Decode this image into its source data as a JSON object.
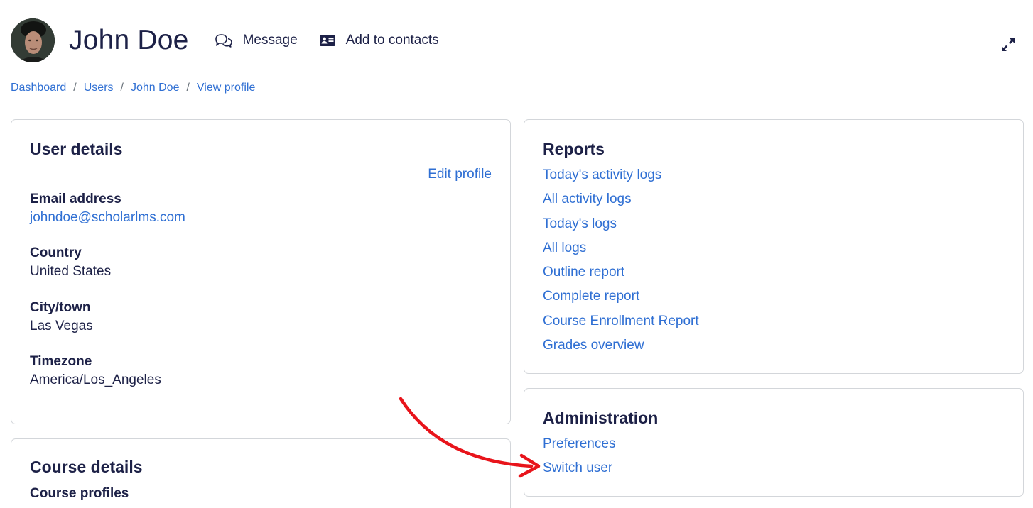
{
  "user": {
    "name": "John Doe"
  },
  "header_actions": {
    "message_label": "Message",
    "add_contacts_label": "Add to contacts"
  },
  "breadcrumb": [
    "Dashboard",
    "Users",
    "John Doe",
    "View profile"
  ],
  "user_details": {
    "title": "User details",
    "edit_label": "Edit profile",
    "fields": [
      {
        "label": "Email address",
        "value": "johndoe@scholarlms.com"
      },
      {
        "label": "Country",
        "value": "United States"
      },
      {
        "label": "City/town",
        "value": "Las Vegas"
      },
      {
        "label": "Timezone",
        "value": "America/Los_Angeles"
      }
    ]
  },
  "course_details": {
    "title": "Course details",
    "subtitle": "Course profiles"
  },
  "reports": {
    "title": "Reports",
    "links": [
      "Today's activity logs",
      "All activity logs",
      "Today's logs",
      "All logs",
      "Outline report",
      "Complete report",
      "Course Enrollment Report",
      "Grades overview"
    ]
  },
  "administration": {
    "title": "Administration",
    "links": [
      "Preferences",
      "Switch user"
    ]
  },
  "colors": {
    "link": "#2f6fd3",
    "heading": "#1d2147",
    "annotation_arrow": "#e8141b"
  }
}
